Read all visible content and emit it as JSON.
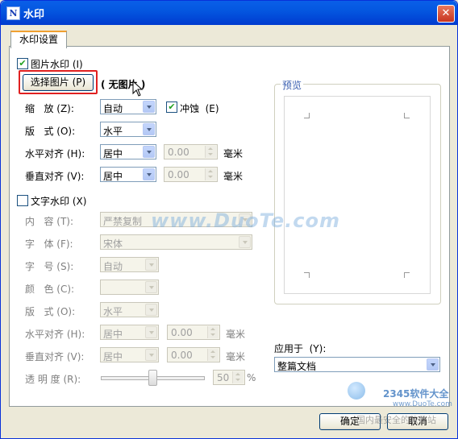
{
  "window": {
    "title": "水印",
    "app_icon": "N",
    "close": "✕"
  },
  "tab": {
    "label": "水印设置"
  },
  "picture": {
    "checkbox_label": "图片水印 (I)",
    "checked": "✔",
    "select_button": "选择图片 (P)",
    "status": "( 无图片 )",
    "scale_label": "缩   放 (Z):",
    "scale_value": "自动",
    "washout_label": "冲蚀  (E)",
    "washout_checked": "✔",
    "layout_label": "版   式 (O):",
    "layout_value": "水平",
    "h_align_label": "水平对齐 (H):",
    "h_align_value": "居中",
    "h_offset": "0.00",
    "h_unit": "毫米",
    "v_align_label": "垂直对齐 (V):",
    "v_align_value": "居中",
    "v_offset": "0.00",
    "v_unit": "毫米"
  },
  "text": {
    "checkbox_label": "文字水印 (X)",
    "content_label": "内   容 (T):",
    "content_value": "严禁复制",
    "font_label": "字   体 (F):",
    "font_value": "宋体",
    "size_label": "字   号 (S):",
    "size_value": "自动",
    "color_label": "颜   色 (C):",
    "layout_label": "版   式 (O):",
    "layout_value": "水平",
    "h_align_label": "水平对齐 (H):",
    "h_align_value": "居中",
    "h_offset": "0.00",
    "h_unit": "毫米",
    "v_align_label": "垂直对齐 (V):",
    "v_align_value": "居中",
    "v_offset": "0.00",
    "v_unit": "毫米",
    "transparency_label": "透 明 度 (R):",
    "transparency_value": "50",
    "transparency_unit": "%",
    "transparency_level": 0.5
  },
  "preview": {
    "label": "预览"
  },
  "apply": {
    "label": "应用于  (Y):",
    "value": "整篇文档"
  },
  "buttons": {
    "ok": "确定",
    "cancel": "取消"
  },
  "overlay": {
    "watermark": "www.DuoTe.com",
    "logo_text": "2345软件大全",
    "logo_url": "www.DuoTe.com",
    "bottom_text": "国内最安全的软件站"
  },
  "colors": {
    "title_bar": "#0457e0",
    "highlight_box": "#e02020"
  }
}
